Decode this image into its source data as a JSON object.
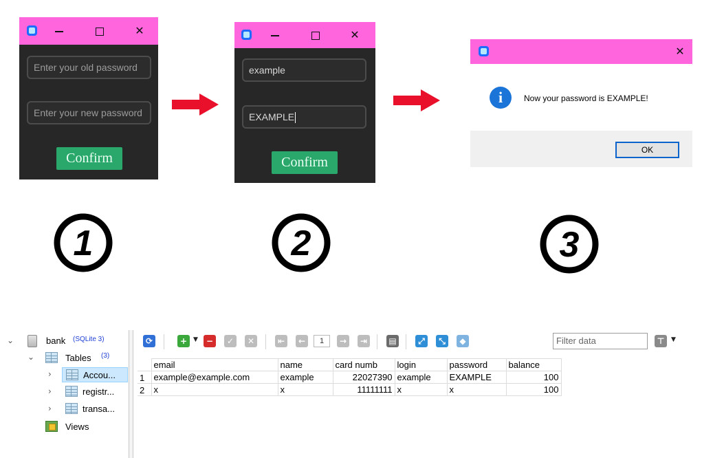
{
  "colors": {
    "titlebar": "#ff66dd",
    "window_bg": "#272727",
    "confirm": "#2aa86b",
    "arrow": "#e8102a",
    "info_icon": "#1b74d8"
  },
  "window1": {
    "old_password_placeholder": "Enter your old password",
    "new_password_placeholder": "Enter your new password",
    "confirm_label": "Confirm",
    "minimize": "—",
    "maximize": "☐",
    "close": "✕"
  },
  "window2": {
    "old_password_value": "example",
    "new_password_value": "EXAMPLE",
    "confirm_label": "Confirm",
    "minimize": "—",
    "maximize": "☐",
    "close": "✕"
  },
  "dialog": {
    "message": "Now your password is EXAMPLE!",
    "ok_label": "OK",
    "close": "✕",
    "icon_glyph": "i"
  },
  "steps": [
    "1",
    "2",
    "3"
  ],
  "db_browser": {
    "tree": {
      "db_name": "bank",
      "db_tag": "(SQLite 3)",
      "tables_label": "Tables",
      "tables_count": "(3)",
      "tables": [
        "Accou...",
        "registr...",
        "transa..."
      ],
      "views_label": "Views"
    },
    "toolbar": {
      "page_number": "1",
      "filter_placeholder": "Filter data"
    },
    "columns": [
      "email",
      "name",
      "card numb",
      "login",
      "password",
      "balance"
    ],
    "rows": [
      {
        "n": "1",
        "email": "example@example.com",
        "name": "example",
        "card": "22027390",
        "login": "example",
        "password": "EXAMPLE",
        "balance": "100"
      },
      {
        "n": "2",
        "email": "x",
        "name": "x",
        "card": "11111111",
        "login": "x",
        "password": "x",
        "balance": "100"
      }
    ]
  }
}
